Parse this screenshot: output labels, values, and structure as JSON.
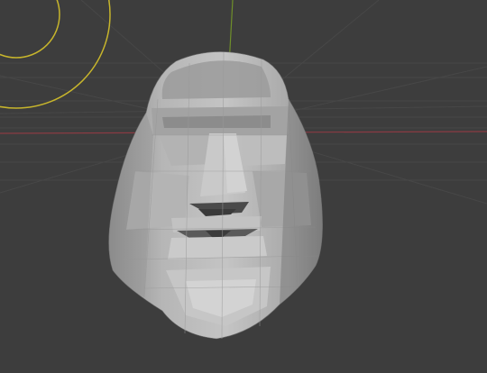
{
  "app": {
    "name": "3D viewport"
  },
  "viewport": {
    "background_color": "#3d3d3d",
    "grid_color": "#474747",
    "x_axis_color": "#8a3b43",
    "y_axis_color": "#6f8f2a",
    "light_gizmo_color": "#c7b52c",
    "object_label": "",
    "icons": {
      "light_gizmo": "light-circle-icon",
      "mesh": "head-mesh-icon"
    }
  }
}
